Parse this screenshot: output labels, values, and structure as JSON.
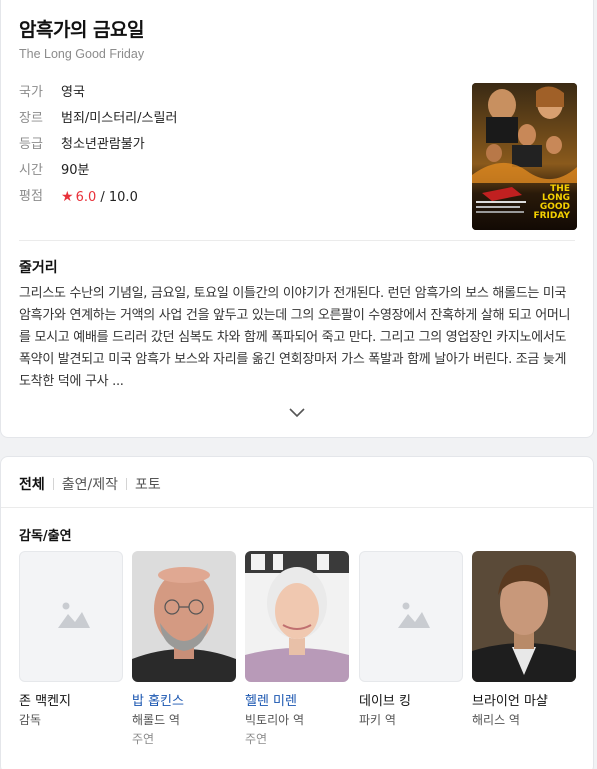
{
  "movie": {
    "title": "암흑가의 금요일",
    "original_title": "The Long Good Friday",
    "info": [
      {
        "label": "국가",
        "value": "영국"
      },
      {
        "label": "장르",
        "value": "범죄/미스터리/스릴러"
      },
      {
        "label": "등급",
        "value": "청소년관람불가"
      },
      {
        "label": "시간",
        "value": "90분"
      }
    ],
    "rating": {
      "label": "평점",
      "star": "★",
      "score": "6.0",
      "max": " / 10.0"
    },
    "poster": {
      "title_lines": [
        "THE",
        "LONG",
        "GOOD",
        "FRIDAY"
      ]
    }
  },
  "synopsis": {
    "heading": "줄거리",
    "text": "그리스도 수난의 기념일, 금요일, 토요일 이틀간의 이야기가 전개된다. 런던 암흑가의 보스 해롤드는 미국 암흑가와 연계하는 거액의 사업 건을 앞두고 있는데 그의 오른팔이 수영장에서 잔혹하게 살해 되고 어머니를 모시고 예배를 드리러 갔던 심복도 차와 함께 폭파되어 죽고 만다. 그리고 그의 영업장인 카지노에서도 폭약이 발견되고 미국 암흑가 보스와 자리를 옮긴 연회장마저 가스 폭발과 함께 날아가 버린다. 조금 늦게 도착한 덕에 구사 ..."
  },
  "tabs": [
    {
      "label": "전체",
      "active": true
    },
    {
      "label": "출연/제작",
      "active": false
    },
    {
      "label": "포토",
      "active": false
    }
  ],
  "cast_heading": "감독/출연",
  "cast": [
    {
      "name": "존 맥켄지",
      "role": "감독",
      "type": "",
      "photo": "placeholder",
      "link": false
    },
    {
      "name": "밥 홉킨스",
      "role": "해롤드 역",
      "type": "주연",
      "photo": "bob",
      "link": true
    },
    {
      "name": "헬렌 미렌",
      "role": "빅토리아 역",
      "type": "주연",
      "photo": "helen",
      "link": true
    },
    {
      "name": "데이브 킹",
      "role": "파키 역",
      "type": "",
      "photo": "placeholder",
      "link": false
    },
    {
      "name": "브라이언 마샬",
      "role": "해리스 역",
      "type": "",
      "photo": "brian",
      "link": false
    }
  ],
  "colors": {
    "accent_red": "#e8313a",
    "link_blue": "#1a56b0"
  }
}
